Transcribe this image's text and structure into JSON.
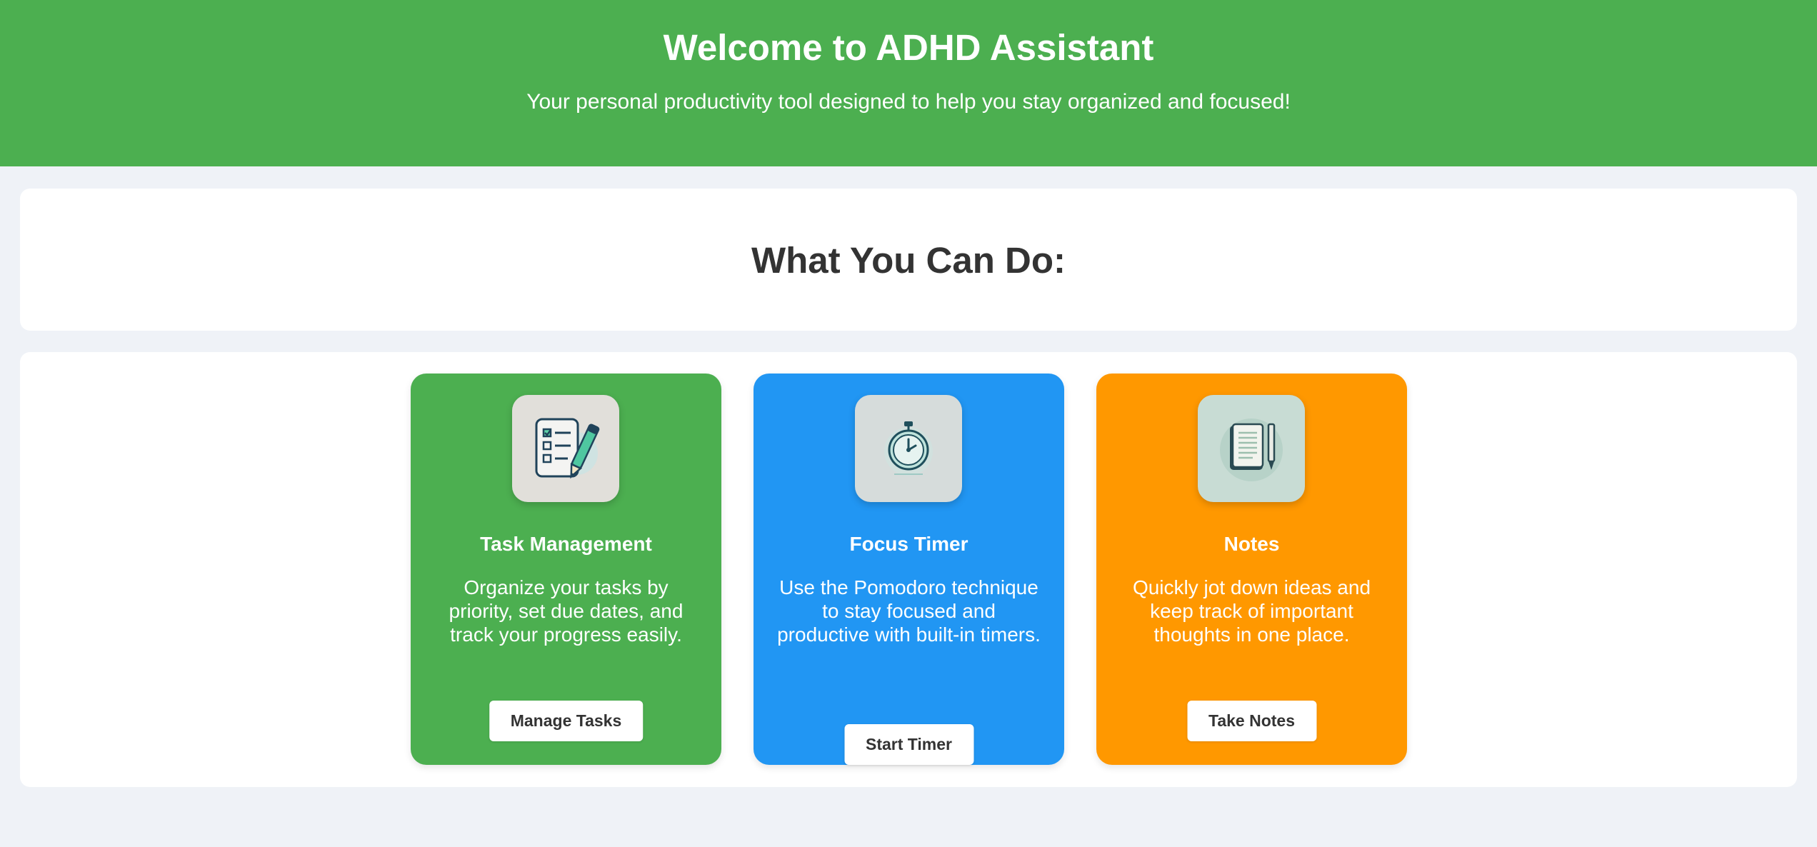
{
  "header": {
    "title": "Welcome to ADHD Assistant",
    "subtitle": "Your personal productivity tool designed to help you stay organized and focused!"
  },
  "section": {
    "heading": "What You Can Do:"
  },
  "cards": [
    {
      "title": "Task Management",
      "description": "Organize your tasks by priority, set due dates, and track your progress easily.",
      "button_label": "Manage Tasks",
      "color": "#4caf50",
      "icon": "checklist-pencil-icon"
    },
    {
      "title": "Focus Timer",
      "description": "Use the Pomodoro technique to stay focused and productive with built-in timers.",
      "button_label": "Start Timer",
      "color": "#2196f3",
      "icon": "stopwatch-icon"
    },
    {
      "title": "Notes",
      "description": "Quickly jot down ideas and keep track of important thoughts in one place.",
      "button_label": "Take Notes",
      "color": "#ff9800",
      "icon": "notebook-pencil-icon"
    }
  ]
}
